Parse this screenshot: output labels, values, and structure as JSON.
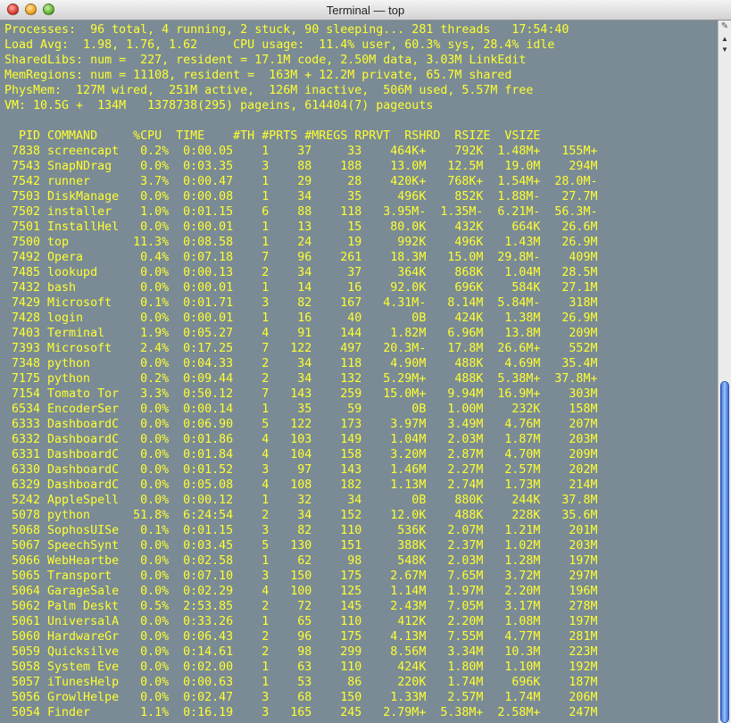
{
  "window": {
    "title": "Terminal — top"
  },
  "summary": [
    "Processes:  96 total, 4 running, 2 stuck, 90 sleeping... 281 threads   17:54:40",
    "Load Avg:  1.98, 1.76, 1.62     CPU usage:  11.4% user, 60.3% sys, 28.4% idle",
    "SharedLibs: num =  227, resident = 17.1M code, 2.50M data, 3.03M LinkEdit",
    "MemRegions: num = 11108, resident =  163M + 12.2M private, 65.7M shared",
    "PhysMem:  127M wired,  251M active,  126M inactive,  506M used, 5.57M free",
    "VM: 10.5G +  134M   1378738(295) pageins, 614404(7) pageouts"
  ],
  "columns": [
    "PID",
    "COMMAND",
    "%CPU",
    "TIME",
    "#TH",
    "#PRTS",
    "#MREGS",
    "RPRVT",
    "RSHRD",
    "RSIZE",
    "VSIZE"
  ],
  "processes": [
    [
      "7838",
      "screencapt",
      "0.2%",
      "0:00.05",
      "1",
      "37",
      "33",
      "464K+",
      "792K",
      "1.48M+",
      "155M+"
    ],
    [
      "7543",
      "SnapNDrag",
      "0.0%",
      "0:03.35",
      "3",
      "88",
      "188",
      "13.0M",
      "12.5M",
      "19.0M",
      "294M"
    ],
    [
      "7542",
      "runner",
      "3.7%",
      "0:00.47",
      "1",
      "29",
      "28",
      "420K+",
      "768K+",
      "1.54M+",
      "28.0M-"
    ],
    [
      "7503",
      "DiskManage",
      "0.0%",
      "0:00.08",
      "1",
      "34",
      "35",
      "496K",
      "852K",
      "1.88M-",
      "27.7M"
    ],
    [
      "7502",
      "installer",
      "1.0%",
      "0:01.15",
      "6",
      "88",
      "118",
      "3.95M-",
      "1.35M-",
      "6.21M-",
      "56.3M-"
    ],
    [
      "7501",
      "InstallHel",
      "0.0%",
      "0:00.01",
      "1",
      "13",
      "15",
      "80.0K",
      "432K",
      "664K",
      "26.6M"
    ],
    [
      "7500",
      "top",
      "11.3%",
      "0:08.58",
      "1",
      "24",
      "19",
      "992K",
      "496K",
      "1.43M",
      "26.9M"
    ],
    [
      "7492",
      "Opera",
      "0.4%",
      "0:07.18",
      "7",
      "96",
      "261",
      "18.3M",
      "15.0M",
      "29.8M-",
      "409M"
    ],
    [
      "7485",
      "lookupd",
      "0.0%",
      "0:00.13",
      "2",
      "34",
      "37",
      "364K",
      "868K",
      "1.04M",
      "28.5M"
    ],
    [
      "7432",
      "bash",
      "0.0%",
      "0:00.01",
      "1",
      "14",
      "16",
      "92.0K",
      "696K",
      "584K",
      "27.1M"
    ],
    [
      "7429",
      "Microsoft",
      "0.1%",
      "0:01.71",
      "3",
      "82",
      "167",
      "4.31M-",
      "8.14M",
      "5.84M-",
      "318M"
    ],
    [
      "7428",
      "login",
      "0.0%",
      "0:00.01",
      "1",
      "16",
      "40",
      "0B",
      "424K",
      "1.38M",
      "26.9M"
    ],
    [
      "7403",
      "Terminal",
      "1.9%",
      "0:05.27",
      "4",
      "91",
      "144",
      "1.82M",
      "6.96M",
      "13.8M",
      "209M"
    ],
    [
      "7393",
      "Microsoft",
      "2.4%",
      "0:17.25",
      "7",
      "122",
      "497",
      "20.3M-",
      "17.8M",
      "26.6M+",
      "552M"
    ],
    [
      "7348",
      "python",
      "0.0%",
      "0:04.33",
      "2",
      "34",
      "118",
      "4.90M",
      "488K",
      "4.69M",
      "35.4M"
    ],
    [
      "7175",
      "python",
      "0.2%",
      "0:09.44",
      "2",
      "34",
      "132",
      "5.29M+",
      "488K",
      "5.38M+",
      "37.8M+"
    ],
    [
      "7154",
      "Tomato Tor",
      "3.3%",
      "0:50.12",
      "7",
      "143",
      "259",
      "15.0M+",
      "9.94M",
      "16.9M+",
      "303M"
    ],
    [
      "6534",
      "EncoderSer",
      "0.0%",
      "0:00.14",
      "1",
      "35",
      "59",
      "0B",
      "1.00M",
      "232K",
      "158M"
    ],
    [
      "6333",
      "DashboardC",
      "0.0%",
      "0:06.90",
      "5",
      "122",
      "173",
      "3.97M",
      "3.49M",
      "4.76M",
      "207M"
    ],
    [
      "6332",
      "DashboardC",
      "0.0%",
      "0:01.86",
      "4",
      "103",
      "149",
      "1.04M",
      "2.03M",
      "1.87M",
      "203M"
    ],
    [
      "6331",
      "DashboardC",
      "0.0%",
      "0:01.84",
      "4",
      "104",
      "158",
      "3.20M",
      "2.87M",
      "4.70M",
      "209M"
    ],
    [
      "6330",
      "DashboardC",
      "0.0%",
      "0:01.52",
      "3",
      "97",
      "143",
      "1.46M",
      "2.27M",
      "2.57M",
      "202M"
    ],
    [
      "6329",
      "DashboardC",
      "0.0%",
      "0:05.08",
      "4",
      "108",
      "182",
      "1.13M",
      "2.74M",
      "1.73M",
      "214M"
    ],
    [
      "5242",
      "AppleSpell",
      "0.0%",
      "0:00.12",
      "1",
      "32",
      "34",
      "0B",
      "880K",
      "244K",
      "37.8M"
    ],
    [
      "5078",
      "python",
      "51.8%",
      "6:24:54",
      "2",
      "34",
      "152",
      "12.0K",
      "488K",
      "228K",
      "35.6M"
    ],
    [
      "5068",
      "SophosUISe",
      "0.1%",
      "0:01.15",
      "3",
      "82",
      "110",
      "536K",
      "2.07M",
      "1.21M",
      "201M"
    ],
    [
      "5067",
      "SpeechSynt",
      "0.0%",
      "0:03.45",
      "5",
      "130",
      "151",
      "388K",
      "2.37M",
      "1.02M",
      "203M"
    ],
    [
      "5066",
      "WebHeartbe",
      "0.0%",
      "0:02.58",
      "1",
      "62",
      "98",
      "548K",
      "2.03M",
      "1.28M",
      "197M"
    ],
    [
      "5065",
      "Transport",
      "0.0%",
      "0:07.10",
      "3",
      "150",
      "175",
      "2.67M",
      "7.65M",
      "3.72M",
      "297M"
    ],
    [
      "5064",
      "GarageSale",
      "0.0%",
      "0:02.29",
      "4",
      "100",
      "125",
      "1.14M",
      "1.97M",
      "2.20M",
      "196M"
    ],
    [
      "5062",
      "Palm Deskt",
      "0.5%",
      "2:53.85",
      "2",
      "72",
      "145",
      "2.43M",
      "7.05M",
      "3.17M",
      "278M"
    ],
    [
      "5061",
      "UniversalA",
      "0.0%",
      "0:33.26",
      "1",
      "65",
      "110",
      "412K",
      "2.20M",
      "1.08M",
      "197M"
    ],
    [
      "5060",
      "HardwareGr",
      "0.0%",
      "0:06.43",
      "2",
      "96",
      "175",
      "4.13M",
      "7.55M",
      "4.77M",
      "281M"
    ],
    [
      "5059",
      "Quicksilve",
      "0.0%",
      "0:14.61",
      "2",
      "98",
      "299",
      "8.56M",
      "3.34M",
      "10.3M",
      "223M"
    ],
    [
      "5058",
      "System Eve",
      "0.0%",
      "0:02.00",
      "1",
      "63",
      "110",
      "424K",
      "1.80M",
      "1.10M",
      "192M"
    ],
    [
      "5057",
      "iTunesHelp",
      "0.0%",
      "0:00.63",
      "1",
      "53",
      "86",
      "220K",
      "1.74M",
      "696K",
      "187M"
    ],
    [
      "5056",
      "GrowlHelpe",
      "0.0%",
      "0:02.47",
      "3",
      "68",
      "150",
      "1.33M",
      "2.57M",
      "1.74M",
      "206M"
    ],
    [
      "5054",
      "Finder",
      "1.1%",
      "0:16.19",
      "3",
      "165",
      "245",
      "2.79M+",
      "5.38M+",
      "2.58M+",
      "247M"
    ]
  ]
}
